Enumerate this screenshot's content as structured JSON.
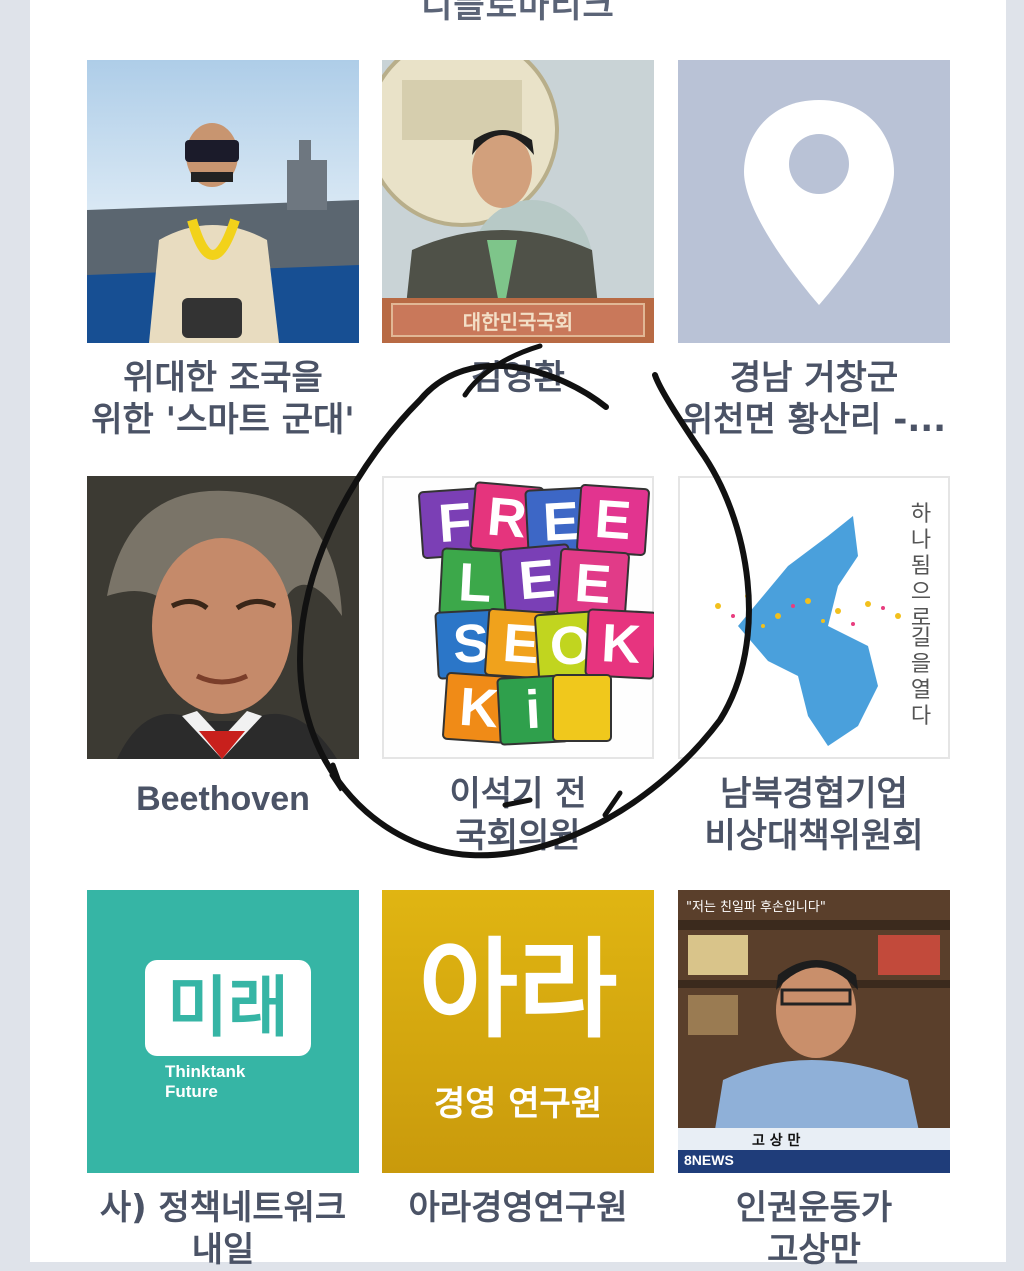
{
  "header": {
    "title": "디플로마티크"
  },
  "tiles": [
    {
      "caption": "위대한 조국을\n위한 '스마트 군대'",
      "image": "navy-officer-aircraft-carrier-photo"
    },
    {
      "caption": "김영환",
      "image": "politician-press-conference-photo",
      "podium_text": "대한민국국회"
    },
    {
      "caption": "경남 거창군\n위천면 황산리 -...",
      "image": "map-pin-icon"
    },
    {
      "caption": "Beethoven",
      "image": "beethoven-portrait"
    },
    {
      "caption": "이석기 전\n국회의원",
      "image": "free-lee-seok-ki-poster",
      "poster_rows": [
        [
          "F",
          "R",
          "E",
          "E"
        ],
        [
          "L",
          "E",
          "E"
        ],
        [
          "S",
          "E",
          "O",
          "K"
        ],
        [
          "K",
          "i"
        ]
      ]
    },
    {
      "caption": "남북경협기업\n비상대책위원회",
      "image": "korean-peninsula-map-art",
      "vertical_text": [
        "하나됨으로",
        "길을열다"
      ]
    },
    {
      "caption": "사) 정책네트워크\n내일",
      "image": "future-thinktank-logo",
      "logo_main": "미래",
      "logo_sub": "Thinktank\nFuture"
    },
    {
      "caption": "아라경영연구원",
      "image": "ara-logo",
      "logo_main": "아라",
      "logo_sub": "경영 연구원"
    },
    {
      "caption": "인권운동가\n고상만",
      "image": "news-interview-photo",
      "news_top": "\"저는 친일파 후손입니다\"",
      "news_name": "고 상 만",
      "news_brand": "8NEWS"
    }
  ],
  "colors": {
    "background": "#dfe3ea",
    "card": "#ffffff",
    "caption": "#4b5366",
    "teal": "#36b5a5",
    "gold": "#d6a90f",
    "pin_bg": "#b9c2d6"
  }
}
